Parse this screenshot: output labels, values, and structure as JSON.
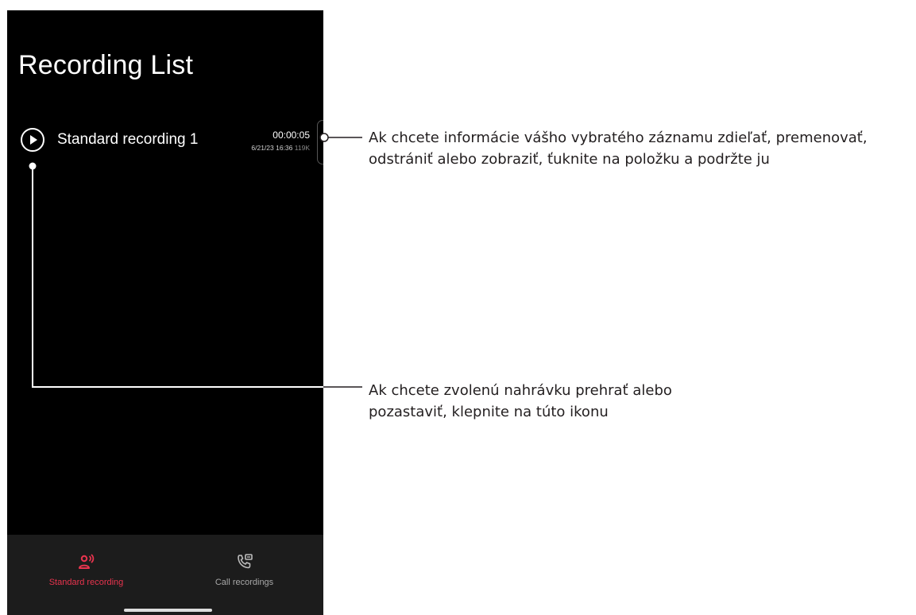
{
  "app": {
    "title": "Recording List"
  },
  "recording_list": {
    "items": [
      {
        "name": "Standard recording 1",
        "duration": "00:00:05",
        "date": "6/21/23 16:36",
        "size": "119K",
        "play_icon": "play-circle-icon"
      }
    ]
  },
  "bottom_nav": {
    "tabs": [
      {
        "label": "Standard recording",
        "icon": "microphone-person-icon",
        "active": true
      },
      {
        "label": "Call recordings",
        "icon": "phone-voicemail-icon",
        "active": false
      }
    ]
  },
  "callouts": {
    "item_options": "Ak chcete informácie vášho vybratého záznamu zdieľať, premenovať, odstrániť alebo zobraziť, ťuknite na položku a podržte ju",
    "play_pause": "Ak chcete zvolenú nahrávku prehrať alebo pozastaviť, klepnite na túto ikonu"
  },
  "colors": {
    "accent": "#e8344e",
    "background": "#000000",
    "nav_background": "#1c1c1c",
    "callout_text": "#231f20"
  }
}
